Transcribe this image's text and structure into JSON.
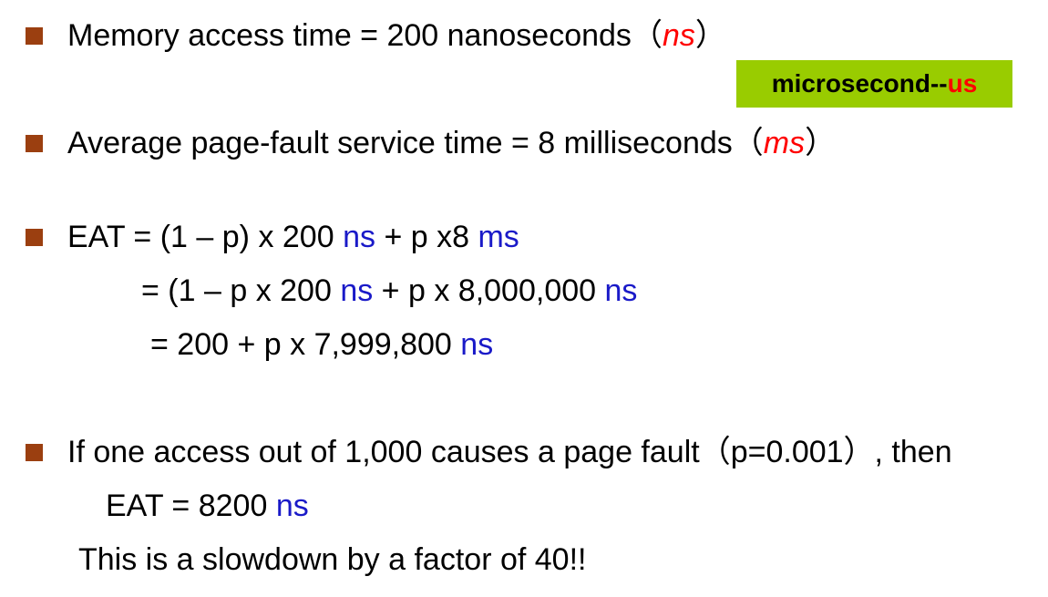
{
  "bullets": {
    "memory": {
      "text": "Memory access time = 200 nanoseconds",
      "paren_open": "（",
      "unit": "ns",
      "paren_close": "）"
    },
    "fault": {
      "text": "Average page-fault service time = 8 milliseconds",
      "paren_open": "（",
      "unit": "ms",
      "paren_close": "）"
    },
    "eat": {
      "line1": {
        "a": "EAT = (1 – p) x 200 ",
        "u1": "ns",
        "b": " + p x8 ",
        "u2": "ms"
      },
      "line2": {
        "a": "= (1 – p  x 200 ",
        "u1": "ns",
        "b": " + p x 8,000,000 ",
        "u2": "ns"
      },
      "line3": {
        "a": "= 200 + p x 7,999,800 ",
        "u1": "ns"
      }
    },
    "example": {
      "text": "If one access out of 1,000 causes a page fault（p=0.001）, then",
      "eat_text": "EAT = 8200 ",
      "eat_unit": "ns",
      "conclusion": "This is a slowdown by a factor of 40!!"
    }
  },
  "badge": {
    "prefix": "microsecond--",
    "highlight": "us"
  },
  "colors": {
    "bullet": "#9b3f10",
    "unit_blue": "#1a1ac8",
    "unit_red": "#ff0000",
    "badge_bg": "#99cc00"
  }
}
